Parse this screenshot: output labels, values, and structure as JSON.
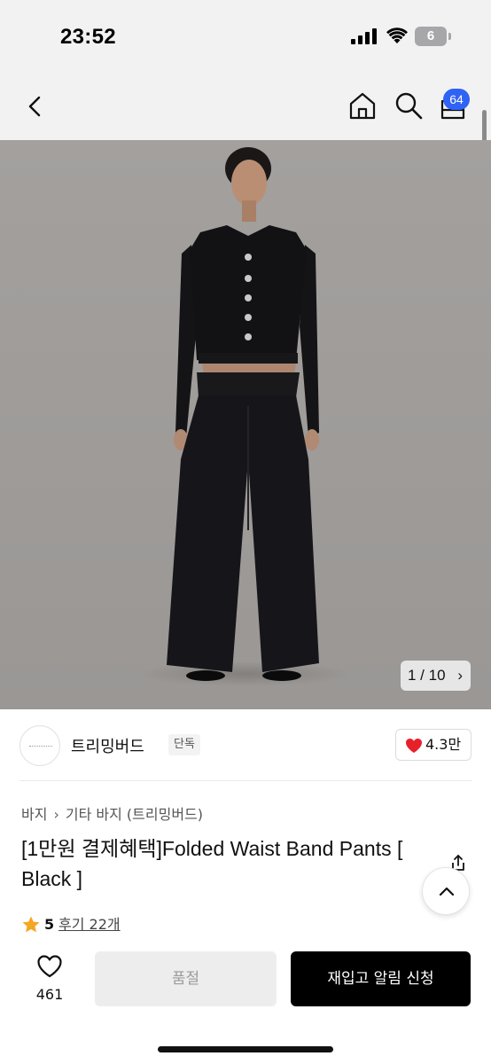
{
  "status_bar": {
    "time": "23:52",
    "battery_level": "6"
  },
  "nav": {
    "cart_count": "64",
    "icons": [
      "back-arrow-icon",
      "home-icon",
      "search-icon",
      "cart-icon"
    ]
  },
  "gallery": {
    "counter": "1 / 10",
    "counter_arrow": "›"
  },
  "brand": {
    "name": "트리밍버드",
    "tag": "단독",
    "likes": "4.3만"
  },
  "breadcrumb": {
    "level1": "바지",
    "separator": "›",
    "level2": "기타 바지 (트리밍버드)"
  },
  "product": {
    "title": "[1만원 결제혜택]Folded Waist Band Pants [ Black ]",
    "rating": "5",
    "reviews": "후기 22개"
  },
  "bottom_bar": {
    "wish_count": "461",
    "soldout_label": "품절",
    "restock_label": "재입고 알림 신청"
  },
  "colors": {
    "accent_badge": "#2f63f5",
    "like_heart": "#e8202a",
    "star": "#f5a623",
    "primary_button": "#000000"
  }
}
